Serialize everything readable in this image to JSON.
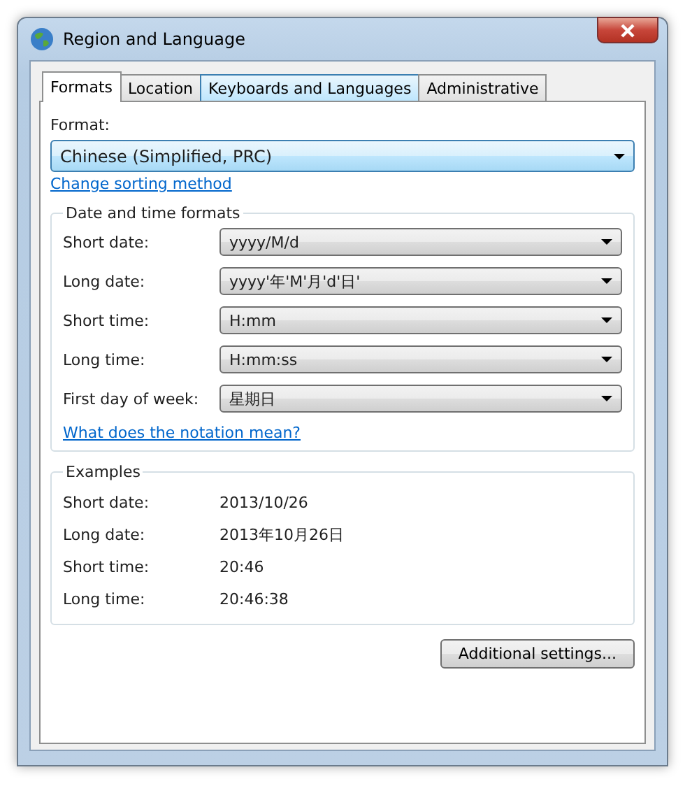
{
  "window": {
    "title": "Region and Language"
  },
  "tabs": [
    {
      "label": "Formats",
      "selected": true
    },
    {
      "label": "Location",
      "selected": false
    },
    {
      "label": "Keyboards and Languages",
      "selected": false,
      "hovered": true
    },
    {
      "label": "Administrative",
      "selected": false
    }
  ],
  "format": {
    "label": "Format:",
    "value": "Chinese (Simplified, PRC)",
    "link": "Change sorting method"
  },
  "date_time_formats": {
    "title": "Date and time formats",
    "rows": [
      {
        "label": "Short date:",
        "value": "yyyy/M/d"
      },
      {
        "label": "Long date:",
        "value": "yyyy'年'M'月'd'日'"
      },
      {
        "label": "Short time:",
        "value": "H:mm"
      },
      {
        "label": "Long time:",
        "value": "H:mm:ss"
      },
      {
        "label": "First day of week:",
        "value": "星期日"
      }
    ],
    "link": "What does the notation mean?"
  },
  "examples": {
    "title": "Examples",
    "rows": [
      {
        "label": "Short date:",
        "value": "2013/10/26"
      },
      {
        "label": "Long date:",
        "value": "2013年10月26日"
      },
      {
        "label": "Short time:",
        "value": "20:46"
      },
      {
        "label": "Long time:",
        "value": "20:46:38"
      }
    ]
  },
  "buttons": [
    "Additional settings..."
  ]
}
